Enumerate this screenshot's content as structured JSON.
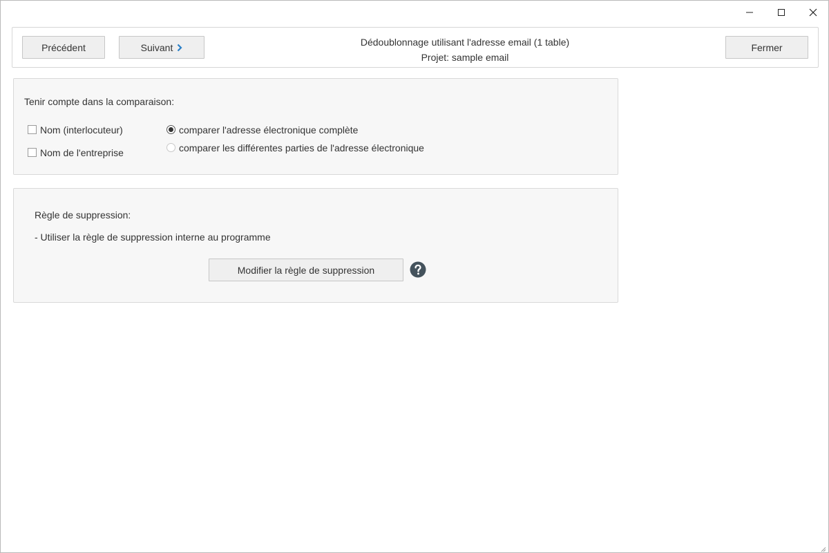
{
  "window": {
    "controls": {
      "minimize_icon": "minimize-icon",
      "maximize_icon": "maximize-icon",
      "close_icon": "close-icon"
    }
  },
  "toolbar": {
    "prev_label": "Précédent",
    "next_label": "Suivant",
    "close_label": "Fermer",
    "title": "Dédoublonnage utilisant l'adresse email (1 table)",
    "project": "Projet: sample email",
    "accent_color": "#2a7fc7"
  },
  "compare": {
    "heading": "Tenir compte dans la comparaison:",
    "checkboxes": [
      {
        "label": "Nom (interlocuteur)",
        "checked": false
      },
      {
        "label": "Nom de l'entreprise",
        "checked": false
      }
    ],
    "radios": [
      {
        "label": "comparer l'adresse électronique complète",
        "selected": true
      },
      {
        "label": "comparer les différentes parties de l'adresse électronique",
        "selected": false
      }
    ]
  },
  "rule": {
    "heading": "Règle de suppression:",
    "description": "- Utiliser la règle de suppression interne au programme",
    "modify_label": "Modifier la règle de suppression",
    "help_icon": "help-icon",
    "help_color": "#44525c"
  }
}
